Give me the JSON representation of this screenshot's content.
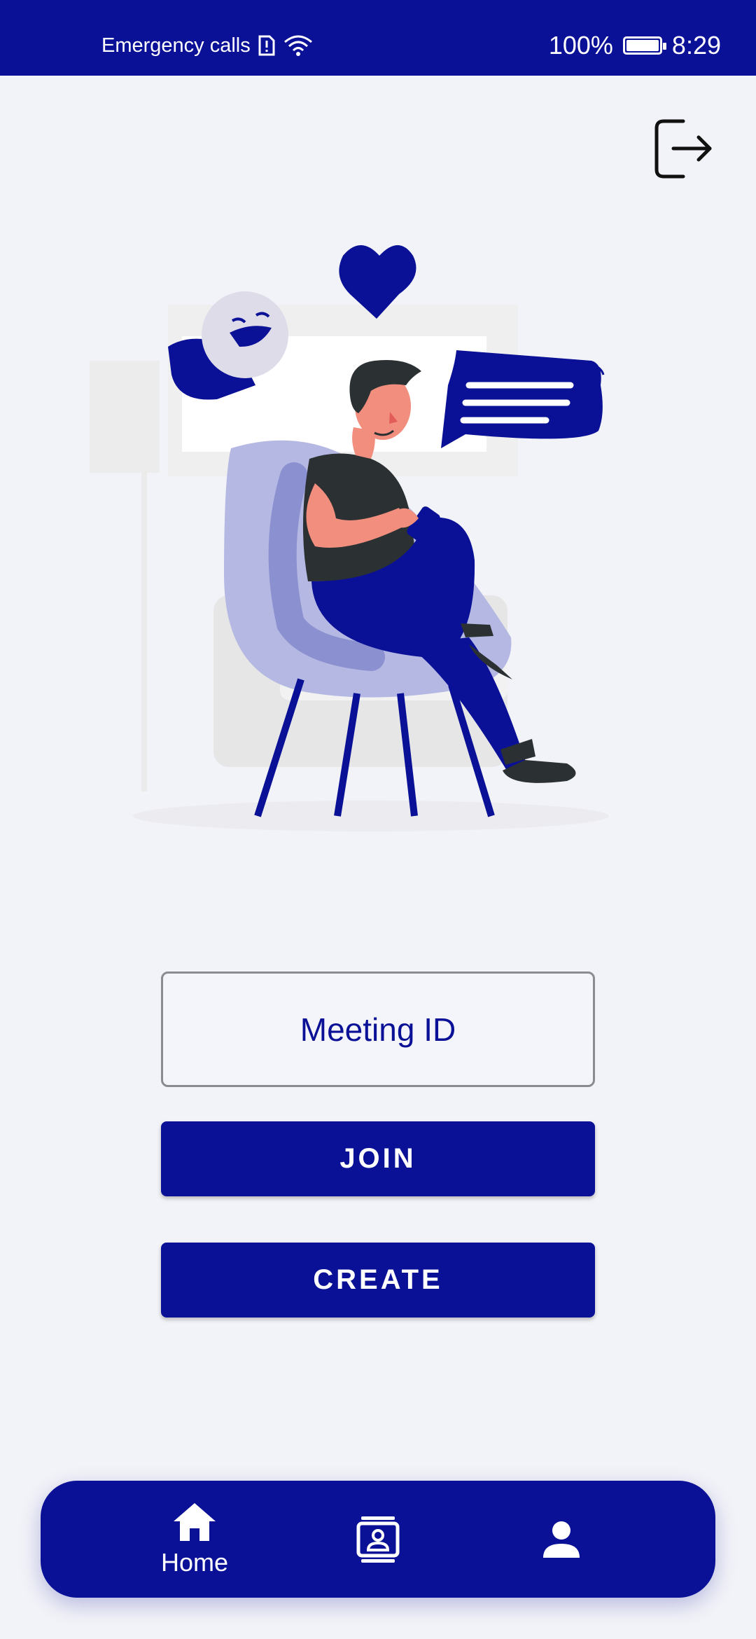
{
  "status_bar": {
    "carrier": "Emergency calls",
    "battery": "100%",
    "time": "8:29"
  },
  "meeting_input": {
    "placeholder": "Meeting ID"
  },
  "buttons": {
    "join": "JOIN",
    "create": "CREATE"
  },
  "bottom_nav": {
    "items": [
      {
        "label": "Home",
        "icon": "home-icon",
        "active": true
      },
      {
        "label": "",
        "icon": "contact-card-icon",
        "active": false
      },
      {
        "label": "",
        "icon": "person-icon",
        "active": false
      }
    ]
  },
  "colors": {
    "primary": "#0a1196",
    "background": "#f2f3f8"
  }
}
